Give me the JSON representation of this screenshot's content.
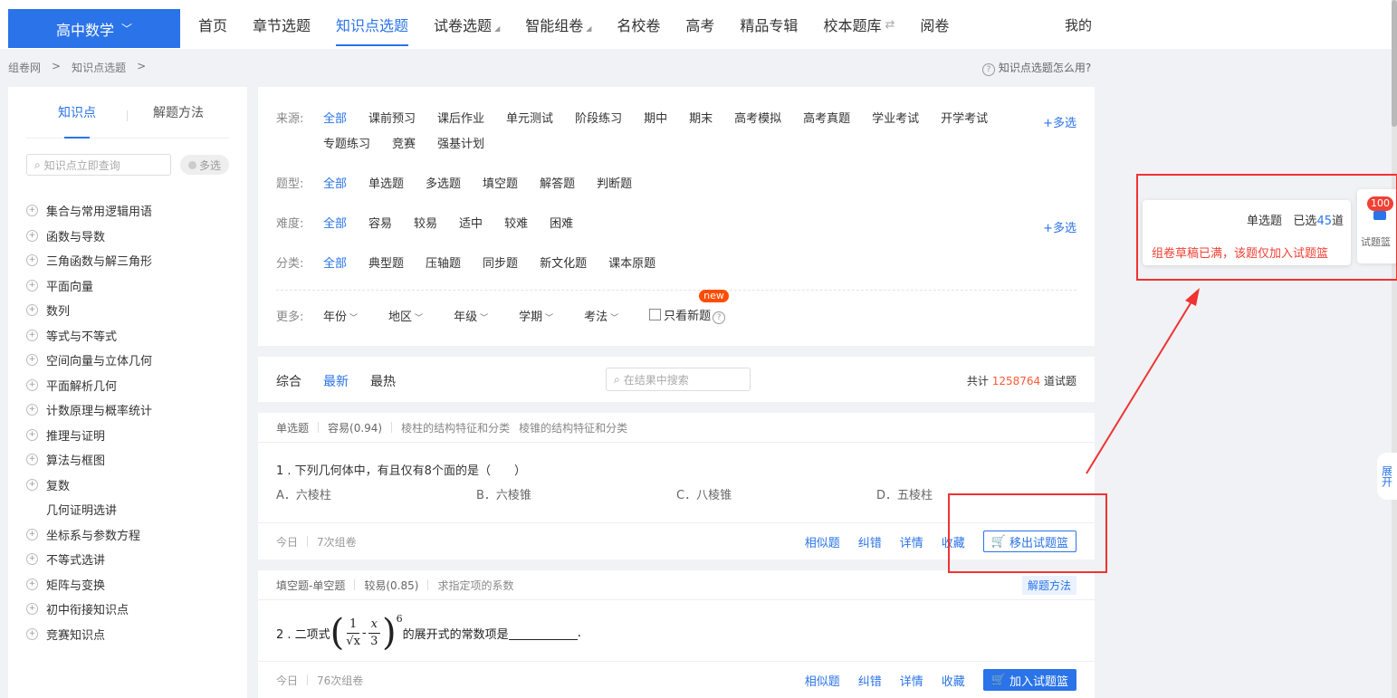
{
  "header": {
    "subject": "高中数学",
    "nav": [
      {
        "label": "首页",
        "active": false,
        "tri": false,
        "swap": false
      },
      {
        "label": "章节选题",
        "active": false,
        "tri": false,
        "swap": false
      },
      {
        "label": "知识点选题",
        "active": true,
        "tri": false,
        "swap": false
      },
      {
        "label": "试卷选题",
        "active": false,
        "tri": true,
        "swap": false
      },
      {
        "label": "智能组卷",
        "active": false,
        "tri": true,
        "swap": false
      },
      {
        "label": "名校卷",
        "active": false,
        "tri": false,
        "swap": false
      },
      {
        "label": "高考",
        "active": false,
        "tri": false,
        "swap": false
      },
      {
        "label": "精品专辑",
        "active": false,
        "tri": false,
        "swap": false
      },
      {
        "label": "校本题库",
        "active": false,
        "tri": false,
        "swap": true
      },
      {
        "label": "阅卷",
        "active": false,
        "tri": false,
        "swap": false
      }
    ],
    "mine": "我的"
  },
  "breadcrumb": {
    "root": "组卷网",
    "sep": ">",
    "current": "知识点选题",
    "sep2": ">"
  },
  "help": "知识点选题怎么用?",
  "sidebar": {
    "tab_knowledge": "知识点",
    "tab_method": "解题方法",
    "search_placeholder": "知识点立即查询",
    "multi": "多选",
    "items": [
      {
        "label": "集合与常用逻辑用语",
        "expandable": true
      },
      {
        "label": "函数与导数",
        "expandable": true
      },
      {
        "label": "三角函数与解三角形",
        "expandable": true
      },
      {
        "label": "平面向量",
        "expandable": true
      },
      {
        "label": "数列",
        "expandable": true
      },
      {
        "label": "等式与不等式",
        "expandable": true
      },
      {
        "label": "空间向量与立体几何",
        "expandable": true
      },
      {
        "label": "平面解析几何",
        "expandable": true
      },
      {
        "label": "计数原理与概率统计",
        "expandable": true
      },
      {
        "label": "推理与证明",
        "expandable": true
      },
      {
        "label": "算法与框图",
        "expandable": true
      },
      {
        "label": "复数",
        "expandable": true
      },
      {
        "label": "几何证明选讲",
        "expandable": false
      },
      {
        "label": "坐标系与参数方程",
        "expandable": true
      },
      {
        "label": "不等式选讲",
        "expandable": true
      },
      {
        "label": "矩阵与变换",
        "expandable": true
      },
      {
        "label": "初中衔接知识点",
        "expandable": true
      },
      {
        "label": "竞赛知识点",
        "expandable": true
      }
    ]
  },
  "filters": {
    "source_label": "来源:",
    "source": [
      "全部",
      "课前预习",
      "课后作业",
      "单元测试",
      "阶段练习",
      "期中",
      "期末",
      "高考模拟",
      "高考真题",
      "学业考试",
      "开学考试",
      "专题练习",
      "竞赛",
      "强基计划"
    ],
    "type_label": "题型:",
    "type": [
      "全部",
      "单选题",
      "多选题",
      "填空题",
      "解答题",
      "判断题"
    ],
    "difficulty_label": "难度:",
    "difficulty": [
      "全部",
      "容易",
      "较易",
      "适中",
      "较难",
      "困难"
    ],
    "category_label": "分类:",
    "category": [
      "全部",
      "典型题",
      "压轴题",
      "同步题",
      "新文化题",
      "课本原题"
    ],
    "more_multi": "+多选",
    "more_label": "更多:",
    "dropdowns": [
      "年份",
      "地区",
      "年级",
      "学期",
      "考法"
    ],
    "only_new": "只看新题",
    "new_badge": "new"
  },
  "sortbar": {
    "options": [
      "综合",
      "最新",
      "最热"
    ],
    "active": "最新",
    "search_placeholder": "在结果中搜索",
    "total_prefix": "共计",
    "total_count": "1258764",
    "total_suffix": "道试题"
  },
  "questions": [
    {
      "type": "单选题",
      "difficulty": "容易(0.94)",
      "knowledge1": "棱柱的结构特征和分类",
      "knowledge2": "棱锥的结构特征和分类",
      "stem": "1 . 下列几何体中，有且仅有8个面的是（　　）",
      "options": [
        "A．六棱柱",
        "B．六棱锥",
        "C．八棱锥",
        "D．五棱柱"
      ],
      "date": "今日",
      "uses": "7次组卷",
      "actions": [
        "相似题",
        "纠错",
        "详情",
        "收藏"
      ],
      "basket_btn": "移出试题篮"
    },
    {
      "type": "填空题-单空题",
      "difficulty": "较易(0.85)",
      "knowledge1": "求指定项的系数",
      "method_btn": "解题方法",
      "stem_prefix": "2 . 二项式",
      "frac1_num": "1",
      "frac1_den": "√x",
      "minus": "-",
      "frac2_num": "x",
      "frac2_den": "3",
      "exponent": "6",
      "stem_suffix": "的展开式的常数项是",
      "stem_end": ".",
      "date": "今日",
      "uses": "76次组卷",
      "actions": [
        "相似题",
        "纠错",
        "详情",
        "收藏"
      ],
      "basket_btn": "加入试题篮"
    }
  ],
  "popup": {
    "type": "单选题",
    "selected_prefix": "已选",
    "selected_count": "45",
    "selected_suffix": "道",
    "warning": "组卷草稿已满，该题仅加入试题篮"
  },
  "basket": {
    "badge": "100",
    "label": "试题篮"
  },
  "expand": "展开",
  "colors": {
    "accent": "#2a73e8",
    "annotation": "#f03232",
    "count": "#ff5a36"
  }
}
